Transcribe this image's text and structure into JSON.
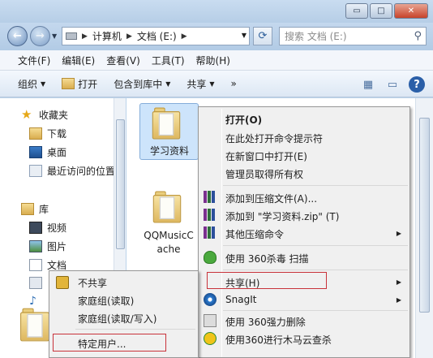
{
  "window": {
    "controls": {
      "minimize": "▭",
      "maximize": "□",
      "close": "✕"
    }
  },
  "address": {
    "segments": [
      "计算机",
      "文档 (E:)"
    ],
    "search_placeholder": "搜索 文档 (E:)"
  },
  "menubar": [
    "文件(F)",
    "编辑(E)",
    "查看(V)",
    "工具(T)",
    "帮助(H)"
  ],
  "toolbar": {
    "organize": "组织",
    "open": "打开",
    "include_in_library": "包含到库中",
    "share": "共享",
    "more": "»"
  },
  "nav": {
    "favorites": "收藏夹",
    "downloads": "下载",
    "desktop": "桌面",
    "recent": "最近访问的位置",
    "libraries": "库",
    "videos": "视频",
    "pictures": "图片",
    "documents": "文档"
  },
  "files": [
    {
      "name": "学习资料"
    },
    {
      "name_line1": "QQMusicC",
      "name_line2": "ache"
    }
  ],
  "context_menu": {
    "open": "打开(O)",
    "cmd_here": "在此处打开命令提示符",
    "open_new_window": "在新窗口中打开(E)",
    "take_ownership": "管理员取得所有权",
    "add_to_archive": "添加到压缩文件(A)...",
    "add_to_zip": "添加到 \"学习资料.zip\" (T)",
    "other_compress": "其他压缩命令",
    "scan_360": "使用 360杀毒 扫描",
    "share": "共享(H)",
    "snagit": "SnagIt",
    "force_delete_360": "使用 360强力删除",
    "cloud_scan_360": "使用360进行木马云查杀"
  },
  "share_submenu": {
    "no_share": "不共享",
    "homegroup_read": "家庭组(读取)",
    "homegroup_readwrite": "家庭组(读取/写入)",
    "specific_users": "特定用户..."
  },
  "colors": {
    "highlight_border": "#c8323a",
    "selection_bg": "#cde4fb",
    "menu_bg": "#f0f0f0"
  }
}
